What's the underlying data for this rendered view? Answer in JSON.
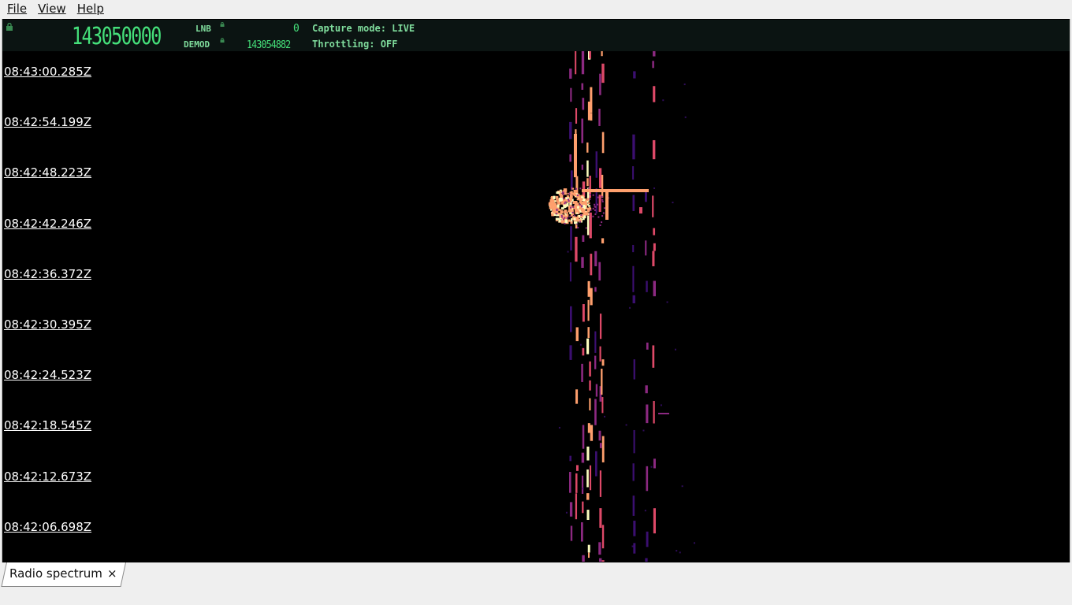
{
  "menu": {
    "file": "File",
    "view": "View",
    "help": "Help"
  },
  "header": {
    "center_frequency": "143050000",
    "lnb_label": "LNB",
    "lnb_value": "0",
    "demod_label": "DEMOD",
    "demod_value": "143054882",
    "capture_mode": "Capture mode: LIVE",
    "throttling": "Throttling: OFF",
    "text_color": "#45e07a"
  },
  "waterfall": {
    "timestamps": [
      "08:43:00.285Z",
      "08:42:54.199Z",
      "08:42:48.223Z",
      "08:42:42.246Z",
      "08:42:36.372Z",
      "08:42:30.395Z",
      "08:42:24.523Z",
      "08:42:18.545Z",
      "08:42:12.673Z",
      "08:42:06.698Z"
    ],
    "colormap": [
      "#000000",
      "#3b0f70",
      "#8c2981",
      "#de4968",
      "#fe9f6d",
      "#fcfdbf"
    ]
  },
  "tabs": [
    {
      "label": "Radio spectrum",
      "close": "×"
    }
  ]
}
